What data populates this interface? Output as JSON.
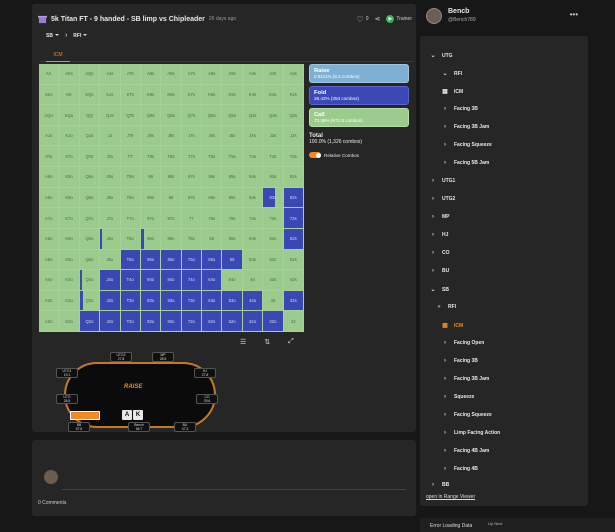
{
  "header": {
    "title": "5k Titan FT - 9 handed - SB limp vs Chipleader",
    "time_ago": "26 days ago",
    "like_count": "0",
    "trainer_label": "Trainer"
  },
  "selectors": {
    "position": "SB",
    "action": "RFI"
  },
  "tabs": [
    "ICM"
  ],
  "colors": {
    "raise": "#7fb0d3",
    "fold": "#3b48b5",
    "call": "#9ccb8e",
    "accent": "#f08a24"
  },
  "grid": {
    "rows": [
      [
        "AA",
        "AKs",
        "AQs",
        "AJs",
        "ATs",
        "A9s",
        "A8s",
        "A7s",
        "A6s",
        "A5s",
        "A4s",
        "A3s",
        "A2s"
      ],
      [
        "AKo",
        "KK",
        "KQs",
        "KJs",
        "KTs",
        "K9s",
        "K8s",
        "K7s",
        "K6s",
        "K5s",
        "K4s",
        "K3s",
        "K2s"
      ],
      [
        "AQo",
        "KQo",
        "QQ",
        "QJs",
        "QTs",
        "Q9s",
        "Q8s",
        "Q7s",
        "Q6s",
        "Q5s",
        "Q4s",
        "Q3s",
        "Q2s"
      ],
      [
        "AJo",
        "KJo",
        "QJo",
        "JJ",
        "JTs",
        "J9s",
        "J8s",
        "J7s",
        "J6s",
        "J5s",
        "J4s",
        "J3s",
        "J2s"
      ],
      [
        "ATo",
        "KTo",
        "QTo",
        "JTo",
        "TT",
        "T9s",
        "T8s",
        "T7s",
        "T6s",
        "T5s",
        "T4s",
        "T3s",
        "T2s"
      ],
      [
        "A9o",
        "K9o",
        "Q9o",
        "J9o",
        "T9o",
        "99",
        "98s",
        "97s",
        "96s",
        "95s",
        "94s",
        "93s",
        "92s"
      ],
      [
        "A8o",
        "K8o",
        "Q8o",
        "J8o",
        "T8o",
        "98o",
        "88",
        "87s",
        "86s",
        "85s",
        "84s",
        "83s",
        "82s"
      ],
      [
        "A7o",
        "K7o",
        "Q7o",
        "J7o",
        "T7o",
        "97o",
        "87o",
        "77",
        "76s",
        "75s",
        "74s",
        "73s",
        "72s"
      ],
      [
        "A6o",
        "K6o",
        "Q6o",
        "J6o",
        "T6o",
        "96o",
        "86o",
        "76o",
        "66",
        "65s",
        "64s",
        "63s",
        "62s"
      ],
      [
        "A5o",
        "K5o",
        "Q5o",
        "J5o",
        "T5o",
        "95o",
        "85o",
        "75o",
        "65o",
        "55",
        "54s",
        "53s",
        "52s"
      ],
      [
        "A4o",
        "K4o",
        "Q4o",
        "J4o",
        "T4o",
        "94o",
        "84o",
        "74o",
        "64o",
        "54o",
        "44",
        "43s",
        "42s"
      ],
      [
        "A3o",
        "K3o",
        "Q3o",
        "J3o",
        "T3o",
        "93o",
        "83o",
        "73o",
        "63o",
        "53o",
        "43o",
        "33",
        "32s"
      ],
      [
        "A2o",
        "K2o",
        "Q2o",
        "J2o",
        "T2o",
        "92o",
        "82o",
        "72o",
        "62o",
        "52o",
        "42o",
        "32o",
        "22"
      ]
    ],
    "fold_fractions": [
      [
        0,
        0,
        0,
        0,
        0,
        0,
        0,
        0,
        0,
        0,
        0,
        0,
        0
      ],
      [
        0,
        0,
        0,
        0,
        0,
        0,
        0,
        0,
        0,
        0,
        0,
        0,
        0
      ],
      [
        0,
        0,
        0,
        0,
        0,
        0,
        0,
        0,
        0,
        0,
        0,
        0,
        0
      ],
      [
        0,
        0,
        0,
        0,
        0,
        0,
        0,
        0,
        0,
        0,
        0,
        0,
        0
      ],
      [
        0,
        0,
        0,
        0,
        0,
        0,
        0,
        0,
        0,
        0,
        0,
        0,
        0
      ],
      [
        0,
        0,
        0,
        0,
        0,
        0,
        0,
        0,
        0,
        0,
        0,
        0,
        0
      ],
      [
        0,
        0,
        0,
        0,
        0,
        0,
        0,
        0,
        0,
        0,
        0,
        0.6,
        1
      ],
      [
        0,
        0,
        0,
        0,
        0,
        0,
        0,
        0,
        0,
        0,
        0,
        0,
        1
      ],
      [
        0,
        0,
        0,
        0.1,
        0,
        0.15,
        0,
        0,
        0,
        0,
        0,
        0,
        1
      ],
      [
        0,
        0,
        0,
        0,
        1,
        1,
        1,
        1,
        1,
        1,
        0,
        0,
        0
      ],
      [
        0,
        0,
        0.1,
        1,
        1,
        1,
        1,
        1,
        1,
        0,
        0,
        0,
        0
      ],
      [
        0,
        0,
        0.15,
        1,
        1,
        1,
        1,
        1,
        1,
        1,
        1,
        0,
        1
      ],
      [
        0,
        0,
        1,
        1,
        1,
        1,
        1,
        1,
        1,
        1,
        1,
        1,
        0
      ]
    ]
  },
  "legend": {
    "raise_label": "Raise",
    "raise_detail": "0.6111% (8.2 combos)",
    "fold_label": "Fold",
    "fold_detail": "26.42% (353 combos)",
    "call_label": "Call",
    "call_detail": "73.36% (972.8 combos)",
    "total_label": "Total",
    "total_detail": "100.0% (1,326 combos)",
    "relative_combos_label": "Relative Combos"
  },
  "table": {
    "logo": "RAISE",
    "board": [
      "A",
      "K"
    ],
    "seats": [
      {
        "name": "UTG2",
        "stack": "27.8"
      },
      {
        "name": "MP",
        "stack": "28.5"
      },
      {
        "name": "UTG1",
        "stack": "19.1"
      },
      {
        "name": "HJ",
        "stack": "27.8"
      },
      {
        "name": "UTG",
        "stack": "26.5"
      },
      {
        "name": "CO",
        "stack": "29.6"
      },
      {
        "name": "BB",
        "stack": "57.6"
      },
      {
        "name": "Bench",
        "stack": "66.7"
      },
      {
        "name": "BU",
        "stack": "47.3"
      }
    ]
  },
  "comments": {
    "count_label": "0 Comments"
  },
  "profile": {
    "name": "Bencb",
    "handle": "@Bench789"
  },
  "tree": [
    {
      "label": "UTG",
      "arrow": "v"
    },
    {
      "label": "RFI",
      "arrow": "v"
    },
    {
      "label": "ICM",
      "arrow": "grid"
    },
    {
      "label": "Facing 3B",
      "arrow": ">"
    },
    {
      "label": "Facing 3B Jam",
      "arrow": ">"
    },
    {
      "label": "Facing Squeeze",
      "arrow": ">"
    },
    {
      "label": "Facing 5B Jam",
      "arrow": ">"
    },
    {
      "label": "UTG1",
      "arrow": ">"
    },
    {
      "label": "UTG2",
      "arrow": ">"
    },
    {
      "label": "MP",
      "arrow": ">"
    },
    {
      "label": "HJ",
      "arrow": ">"
    },
    {
      "label": "CO",
      "arrow": ">"
    },
    {
      "label": "BU",
      "arrow": ">"
    },
    {
      "label": "SB",
      "arrow": "v"
    },
    {
      "label": "RFI",
      "arrow": "cursor"
    },
    {
      "label": "ICM",
      "arrow": "grid-sel"
    },
    {
      "label": "Facing Open",
      "arrow": ">"
    },
    {
      "label": "Facing 3B",
      "arrow": ">"
    },
    {
      "label": "Facing 3B Jam",
      "arrow": ">"
    },
    {
      "label": "Squeeze",
      "arrow": ">"
    },
    {
      "label": "Facing Squeeze",
      "arrow": ">"
    },
    {
      "label": "Limp Facing Action",
      "arrow": ">"
    },
    {
      "label": "Facing 4B Jam",
      "arrow": ">"
    },
    {
      "label": "Facing 4B",
      "arrow": ">"
    },
    {
      "label": "BB",
      "arrow": ">"
    }
  ],
  "open_link": "open in Range Viewer",
  "footer": {
    "error": "Error Loading Data",
    "up_next": "Up Next"
  }
}
